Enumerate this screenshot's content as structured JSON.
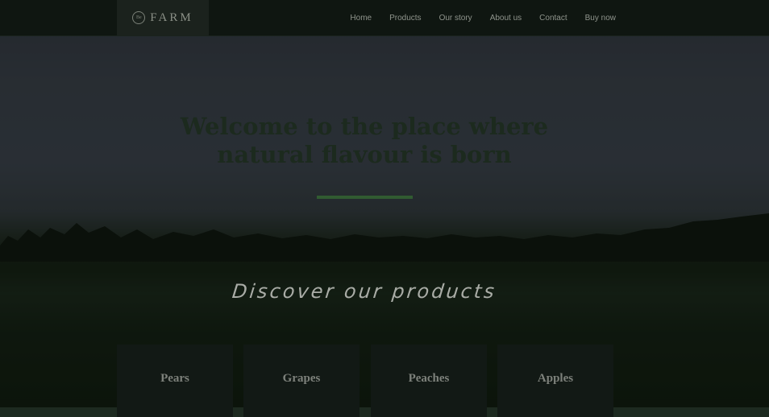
{
  "brand": {
    "badge": "Be",
    "name": "FARM"
  },
  "nav": {
    "items": [
      {
        "label": "Home"
      },
      {
        "label": "Products"
      },
      {
        "label": "Our story"
      },
      {
        "label": "About us"
      },
      {
        "label": "Contact"
      },
      {
        "label": "Buy now"
      }
    ]
  },
  "hero": {
    "headline_line1": "Welcome to the place where",
    "headline_line2": "natural flavour is born",
    "discover": "Discover our products"
  },
  "products": [
    {
      "label": "Pears"
    },
    {
      "label": "Grapes"
    },
    {
      "label": "Peaches"
    },
    {
      "label": "Apples"
    }
  ],
  "colors": {
    "accent": "#315b31",
    "navbar": "#0f1611",
    "card": "#121915"
  }
}
